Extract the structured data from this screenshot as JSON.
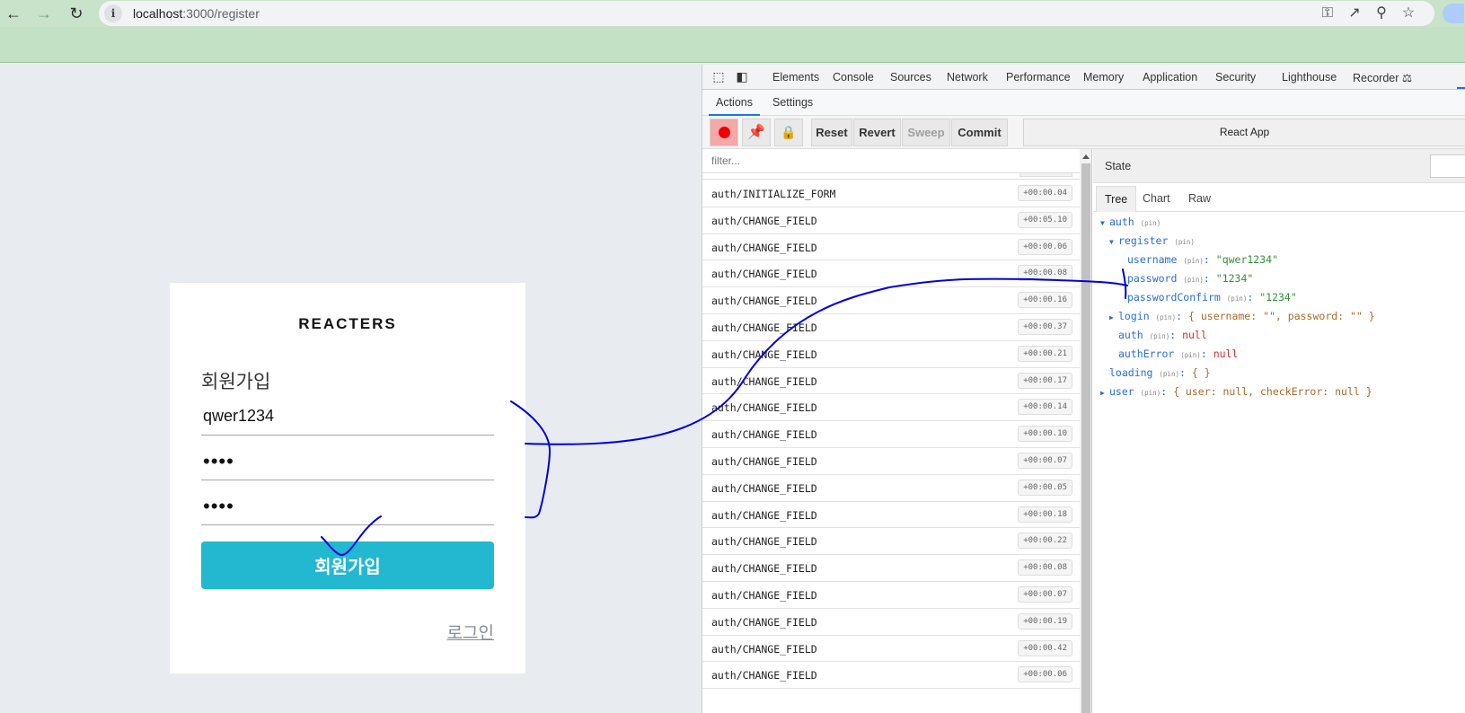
{
  "browser": {
    "url_host": "localhost",
    "url_path": ":3000/register"
  },
  "app": {
    "logo": "REACTERS",
    "heading": "회원가입",
    "username_value": "qwer1234",
    "password_value": "1234",
    "password_confirm_value": "1234",
    "submit_label": "회원가입",
    "login_link": "로그인"
  },
  "devtools": {
    "tabs": [
      "Elements",
      "Console",
      "Sources",
      "Network",
      "Performance",
      "Memory",
      "Application",
      "Security",
      "Lighthouse",
      "Recorder"
    ],
    "sub_tabs": [
      "Actions",
      "Settings"
    ],
    "toolbar": {
      "reset": "Reset",
      "revert": "Revert",
      "sweep": "Sweep",
      "commit": "Commit",
      "instance": "React App"
    },
    "filter_placeholder": "filter...",
    "actions": [
      {
        "name": "auth/INITIALIZE_FORM",
        "time": "+00:00.04"
      },
      {
        "name": "auth/CHANGE_FIELD",
        "time": "+00:05.10"
      },
      {
        "name": "auth/CHANGE_FIELD",
        "time": "+00:00.06"
      },
      {
        "name": "auth/CHANGE_FIELD",
        "time": "+00:00.08"
      },
      {
        "name": "auth/CHANGE_FIELD",
        "time": "+00:00.16"
      },
      {
        "name": "auth/CHANGE_FIELD",
        "time": "+00:00.37"
      },
      {
        "name": "auth/CHANGE_FIELD",
        "time": "+00:00.21"
      },
      {
        "name": "auth/CHANGE_FIELD",
        "time": "+00:00.17"
      },
      {
        "name": "auth/CHANGE_FIELD",
        "time": "+00:00.14"
      },
      {
        "name": "auth/CHANGE_FIELD",
        "time": "+00:00.10"
      },
      {
        "name": "auth/CHANGE_FIELD",
        "time": "+00:00.07"
      },
      {
        "name": "auth/CHANGE_FIELD",
        "time": "+00:00.05"
      },
      {
        "name": "auth/CHANGE_FIELD",
        "time": "+00:00.18"
      },
      {
        "name": "auth/CHANGE_FIELD",
        "time": "+00:00.22"
      },
      {
        "name": "auth/CHANGE_FIELD",
        "time": "+00:00.08"
      },
      {
        "name": "auth/CHANGE_FIELD",
        "time": "+00:00.07"
      },
      {
        "name": "auth/CHANGE_FIELD",
        "time": "+00:00.19"
      },
      {
        "name": "auth/CHANGE_FIELD",
        "time": "+00:00.42"
      },
      {
        "name": "auth/CHANGE_FIELD",
        "time": "+00:00.06"
      }
    ],
    "state": {
      "title": "State",
      "tabs": [
        "Tree",
        "Chart",
        "Raw"
      ],
      "pin_label": "(pin)",
      "auth_key": "auth",
      "register_key": "register",
      "username_key": "username",
      "username_val": "\"qwer1234\"",
      "password_key": "password",
      "password_val": "\"1234\"",
      "password_confirm_key": "passwordConfirm",
      "password_confirm_val": "\"1234\"",
      "login_key": "login",
      "login_val": "{ username: \"\", password: \"\" }",
      "auth_auth_key": "auth",
      "auth_auth_val": "null",
      "auth_error_key": "authError",
      "auth_error_val": "null",
      "loading_key": "loading",
      "loading_val": "{ }",
      "user_key": "user",
      "user_val": "{ user: null, checkError: null }"
    }
  },
  "colors": {
    "accent": "#22b8cf",
    "chrome_green": "#c3e1c4",
    "annotation_ink": "#0000dd"
  }
}
